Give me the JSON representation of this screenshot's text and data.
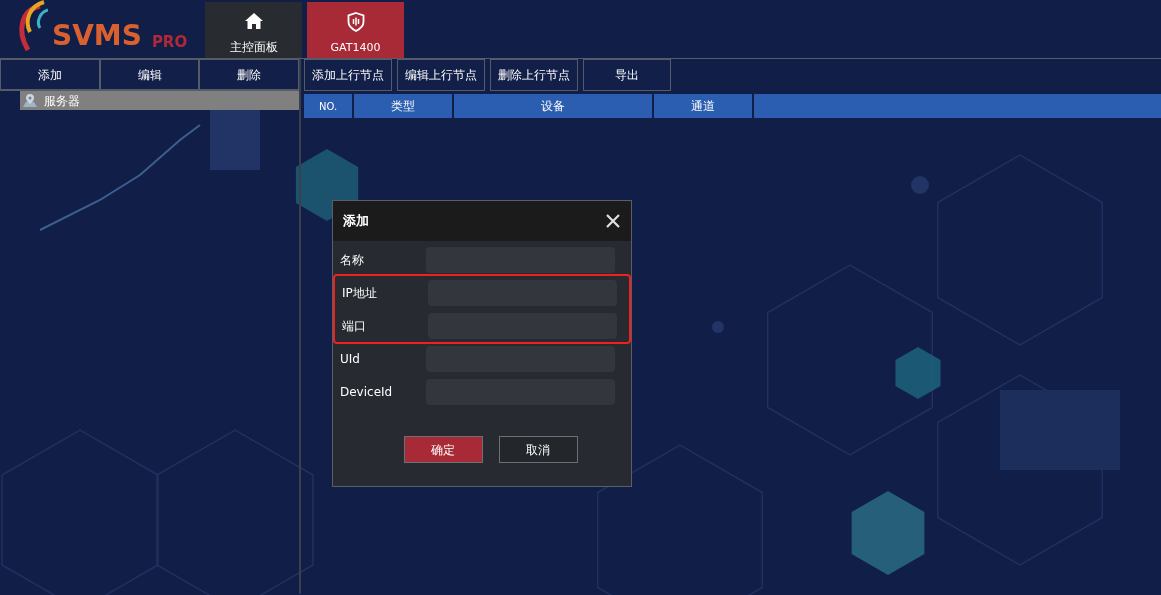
{
  "logo": {
    "name": "SVMS",
    "suffix": "PRO"
  },
  "nav_tabs": [
    {
      "label": "主控面板",
      "selected": false
    },
    {
      "label": "GAT1400",
      "selected": true
    }
  ],
  "left_toolbar": [
    "添加",
    "编辑",
    "删除"
  ],
  "tree": [
    {
      "label": "服务器",
      "selected": true
    }
  ],
  "right_toolbar": [
    "添加上行节点",
    "编辑上行节点",
    "删除上行节点",
    "导出"
  ],
  "table": {
    "columns": [
      "NO.",
      "类型",
      "设备",
      "通道"
    ]
  },
  "dialog": {
    "title": "添加",
    "fields": [
      {
        "label": "名称",
        "highlighted": false
      },
      {
        "label": "IP地址",
        "highlighted": true
      },
      {
        "label": "端口",
        "highlighted": true
      },
      {
        "label": "UId",
        "highlighted": false
      },
      {
        "label": "DeviceId",
        "highlighted": false
      }
    ],
    "buttons": [
      {
        "label": "确定",
        "kind": "primary"
      },
      {
        "label": "取消",
        "kind": "secondary"
      }
    ]
  }
}
